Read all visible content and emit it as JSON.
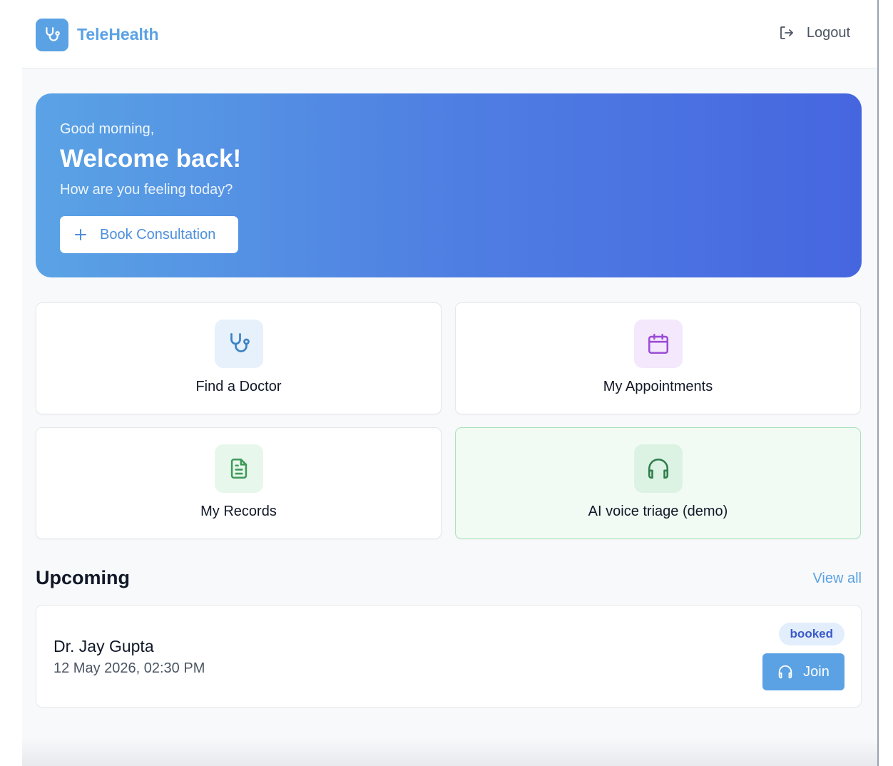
{
  "header": {
    "brand_name": "TeleHealth",
    "brand_icon": "stethoscope-icon",
    "logout_label": "Logout",
    "logout_icon": "logout-icon"
  },
  "hero": {
    "greeting": "Good morning,",
    "title": "Welcome back!",
    "subtitle": "How are you feeling today?",
    "book_button_label": "Book Consultation",
    "book_button_icon": "plus-icon"
  },
  "quick_actions": [
    {
      "label": "Find a Doctor",
      "icon": "stethoscope-icon",
      "color": "#3b82c4"
    },
    {
      "label": "My Appointments",
      "icon": "calendar-icon",
      "color": "#9b4dd6"
    },
    {
      "label": "My Records",
      "icon": "document-icon",
      "color": "#3f9a5a"
    },
    {
      "label": "AI voice triage (demo)",
      "icon": "headphones-icon",
      "color": "#2f7d4c"
    }
  ],
  "upcoming": {
    "title": "Upcoming",
    "view_all_label": "View all",
    "items": [
      {
        "doctor": "Dr. Jay Gupta",
        "datetime": "12 May 2026, 02:30 PM",
        "status": "booked",
        "join_label": "Join"
      }
    ]
  },
  "colors": {
    "brand": "#5aa2e4",
    "hero_gradient_start": "#5aa3e5",
    "hero_gradient_end": "#4666e0"
  }
}
